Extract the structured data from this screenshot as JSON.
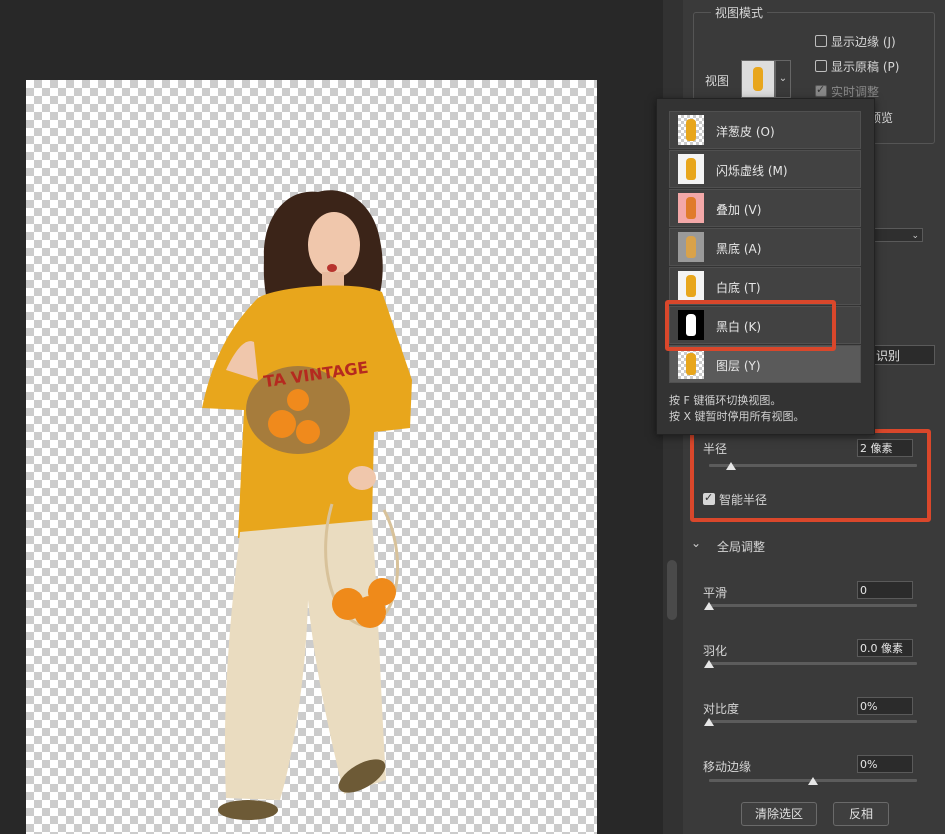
{
  "view_mode": {
    "group_title": "视图模式",
    "view_label": "视图",
    "show_edge": "显示边缘 (J)",
    "show_original": "显示原稿 (P)",
    "realtime_adjust": "实时调整",
    "hq_preview_partial": "预览",
    "options": [
      {
        "label": "洋葱皮 (O)",
        "thumb": "checker"
      },
      {
        "label": "闪烁虚线 (M)",
        "thumb": "white"
      },
      {
        "label": "叠加 (V)",
        "thumb": "pink"
      },
      {
        "label": "黑底 (A)",
        "thumb": "gray"
      },
      {
        "label": "白底 (T)",
        "thumb": "white"
      },
      {
        "label": "黑白 (K)",
        "thumb": "black"
      },
      {
        "label": "图层 (Y)",
        "thumb": "checker"
      }
    ],
    "hint_f": "按 F 键循环切换视图。",
    "hint_x": "按 X 键暂时停用所有视图。"
  },
  "edge_detection": {
    "recognize_button_partial": "识别",
    "radius_label": "半径",
    "radius_value": "2 像素",
    "radius_slider_fraction": 0.04,
    "smart_radius_label": "智能半径"
  },
  "global_adjust": {
    "section_title": "全局调整",
    "smooth_label": "平滑",
    "smooth_value": "0",
    "feather_label": "羽化",
    "feather_value": "0.0 像素",
    "contrast_label": "对比度",
    "contrast_value": "0%",
    "shift_edge_label": "移动边缘",
    "shift_edge_value": "0%",
    "shift_edge_slider_fraction": 0.5
  },
  "buttons": {
    "clear_selection": "清除选区",
    "invert": "反相"
  },
  "colors": {
    "highlight_red": "#d9472b",
    "shirt": "#e8a61c",
    "pants": "#eadcc0"
  }
}
